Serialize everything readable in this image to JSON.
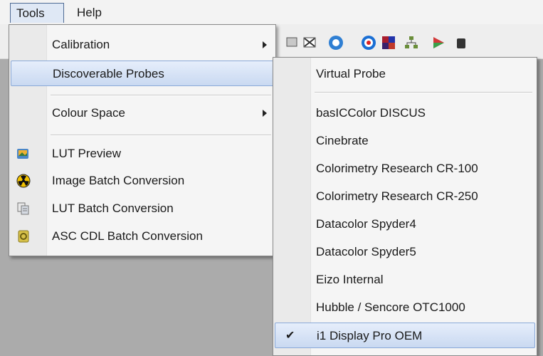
{
  "menubar": {
    "tools": "Tools",
    "help": "Help"
  },
  "tools_menu": {
    "calibration": "Calibration",
    "discoverable_probes": "Discoverable Probes",
    "colour_space": "Colour Space",
    "lut_preview": "LUT Preview",
    "image_batch": "Image Batch Conversion",
    "lut_batch": "LUT Batch Conversion",
    "asc_cdl": "ASC CDL  Batch Conversion"
  },
  "probes_menu": {
    "items": [
      "Virtual Probe",
      "basICColor DISCUS",
      "Cinebrate",
      "Colorimetry Research CR-100",
      "Colorimetry Research CR-250",
      "Datacolor Spyder4",
      "Datacolor Spyder5",
      "Eizo Internal",
      "Hubble / Sencore OTC1000",
      "i1 Display Pro OEM"
    ],
    "checked_item": "i1 Display Pro OEM"
  },
  "icons": {
    "lut_preview": "lut-preview-icon",
    "image_batch": "radiation-icon",
    "lut_batch": "lut-batch-icon",
    "asc_cdl": "asc-cdl-icon",
    "check": "check-icon",
    "submenu": "chevron-right-icon"
  },
  "colors": {
    "highlight": "#c9d9f1",
    "highlight_border": "#8aa9d8"
  }
}
